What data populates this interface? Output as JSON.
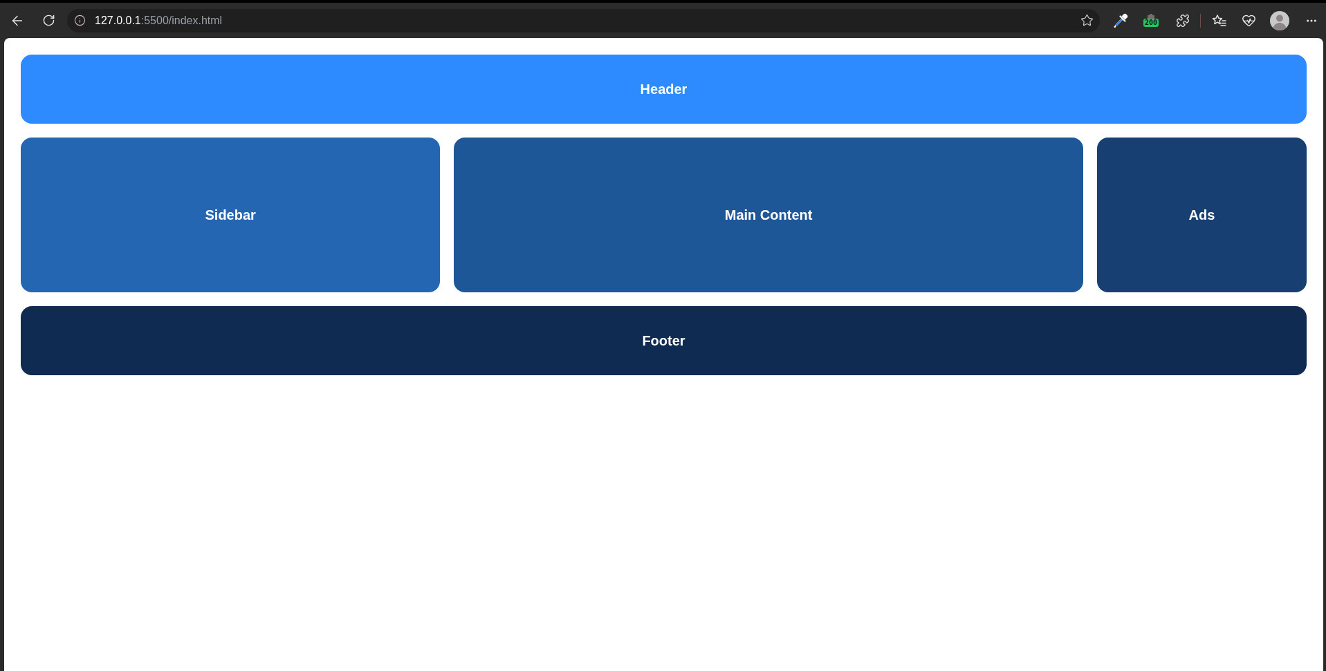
{
  "browser": {
    "url": {
      "host": "127.0.0.1",
      "path": ":5500/index.html"
    },
    "extension_count": "200"
  },
  "page": {
    "header": {
      "label": "Header",
      "color": "#2d8bff"
    },
    "columns": [
      {
        "label": "Sidebar",
        "color": "#2466b2"
      },
      {
        "label": "Main Content",
        "color": "#1e5798"
      },
      {
        "label": "Ads",
        "color": "#173f72"
      }
    ],
    "footer": {
      "label": "Footer",
      "color": "#0f2b51"
    }
  }
}
